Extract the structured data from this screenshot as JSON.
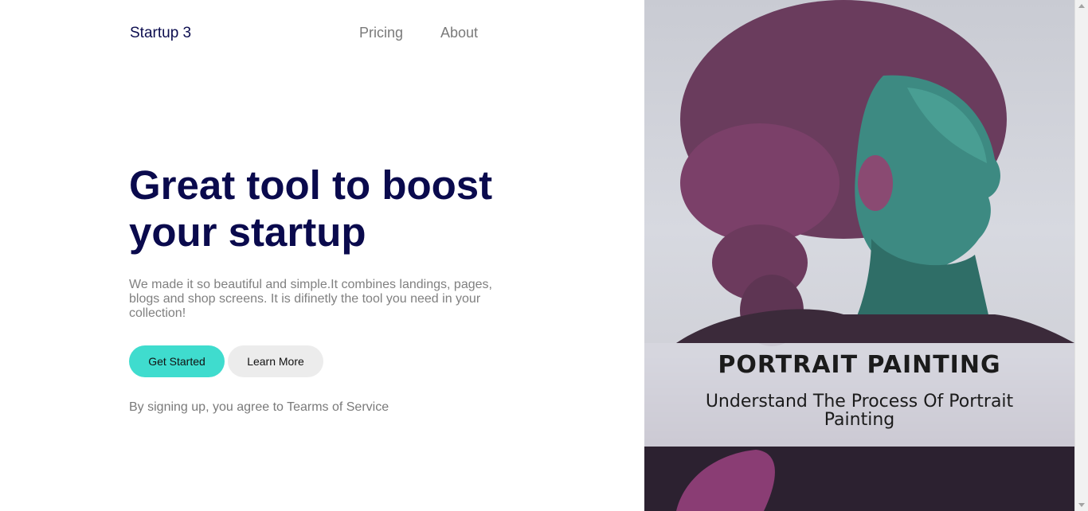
{
  "header": {
    "brand": "Startup 3",
    "nav": {
      "pricing": "Pricing",
      "about": "About"
    }
  },
  "hero": {
    "headline": "Great tool to boost your startup",
    "lead": "We made it so beautiful and simple.It combines landings, pages, blogs and shop screens. It is difinetly the tool you need in your collection!",
    "primary_button": "Get Started",
    "secondary_button": "Learn More",
    "terms": "By signing up, you agree to Tearms of Service"
  },
  "book_cover": {
    "title": "PORTRAIT PAINTING",
    "subtitle": "Understand The Process Of Portrait Painting"
  },
  "colors": {
    "brand_text": "#0c0d4f",
    "headline": "#0a0a4d",
    "primary_button": "#3fdcce",
    "secondary_button": "#ececec",
    "muted_text": "#7a7a7a"
  }
}
